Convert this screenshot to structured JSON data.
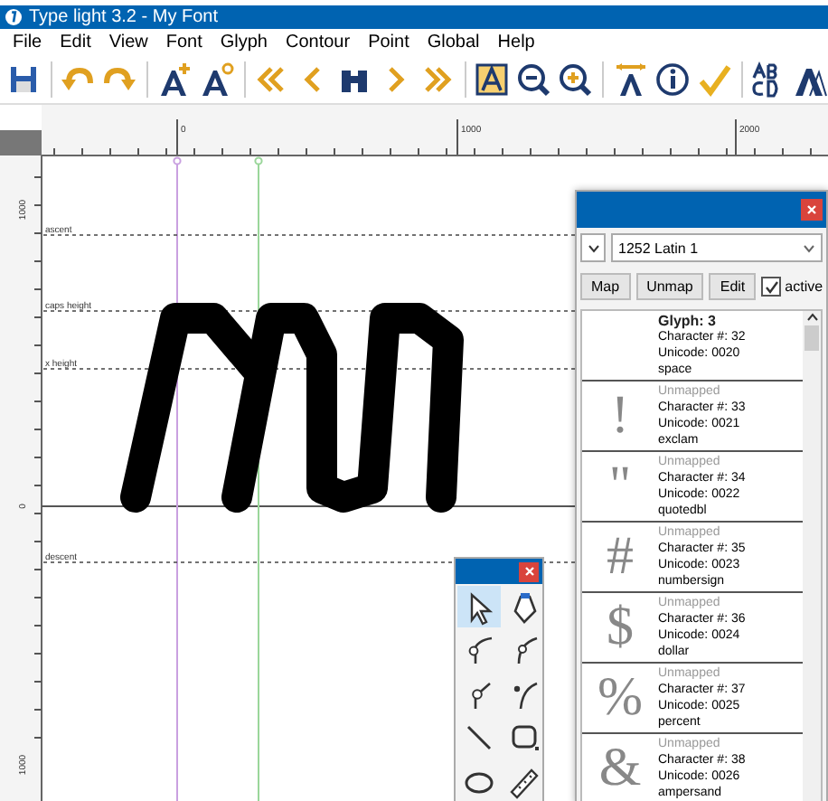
{
  "window": {
    "title": "Type light 3.2  -  My Font"
  },
  "menu": [
    "File",
    "Edit",
    "View",
    "Font",
    "Glyph",
    "Contour",
    "Point",
    "Global",
    "Help"
  ],
  "ruler": {
    "top_labels": [
      "0",
      "1000",
      "2000"
    ],
    "side_labels": [
      "1000",
      "0",
      "1000"
    ]
  },
  "guides": [
    {
      "label": "ascent"
    },
    {
      "label": "caps height"
    },
    {
      "label": "x height"
    },
    {
      "label": "descent"
    }
  ],
  "glyph_panel": {
    "codepage": "1252 Latin 1",
    "buttons": [
      "Map",
      "Unmap",
      "Edit"
    ],
    "active": {
      "label": "active",
      "checked": true
    },
    "glyphs": [
      {
        "status": "Glyph: 3",
        "mapped": true,
        "character": "Character #: 32",
        "unicode": "Unicode: 0020",
        "name": "space"
      },
      {
        "preview": "!",
        "status": "Unmapped",
        "mapped": false,
        "character": "Character #: 33",
        "unicode": "Unicode: 0021",
        "name": "exclam"
      },
      {
        "preview": "\"",
        "status": "Unmapped",
        "mapped": false,
        "character": "Character #: 34",
        "unicode": "Unicode: 0022",
        "name": "quotedbl"
      },
      {
        "preview": "#",
        "status": "Unmapped",
        "mapped": false,
        "character": "Character #: 35",
        "unicode": "Unicode: 0023",
        "name": "numbersign"
      },
      {
        "preview": "$",
        "status": "Unmapped",
        "mapped": false,
        "character": "Character #: 36",
        "unicode": "Unicode: 0024",
        "name": "dollar"
      },
      {
        "preview": "%",
        "status": "Unmapped",
        "mapped": false,
        "character": "Character #: 37",
        "unicode": "Unicode: 0025",
        "name": "percent"
      },
      {
        "preview": "&",
        "status": "Unmapped",
        "mapped": false,
        "character": "Character #: 38",
        "unicode": "Unicode: 0026",
        "name": "ampersand"
      }
    ]
  },
  "tool_palette": {
    "tools": [
      {
        "kind": "pointer",
        "selected": true
      },
      {
        "kind": "pen",
        "selected": false
      },
      {
        "kind": "curve-point",
        "selected": false
      },
      {
        "kind": "smooth-point",
        "selected": false
      },
      {
        "kind": "corner-point",
        "selected": false
      },
      {
        "kind": "tangent-point",
        "selected": false
      },
      {
        "kind": "line",
        "selected": false
      },
      {
        "kind": "rectangle",
        "selected": false
      },
      {
        "kind": "ellipse",
        "selected": false
      },
      {
        "kind": "measure",
        "selected": false
      }
    ]
  }
}
